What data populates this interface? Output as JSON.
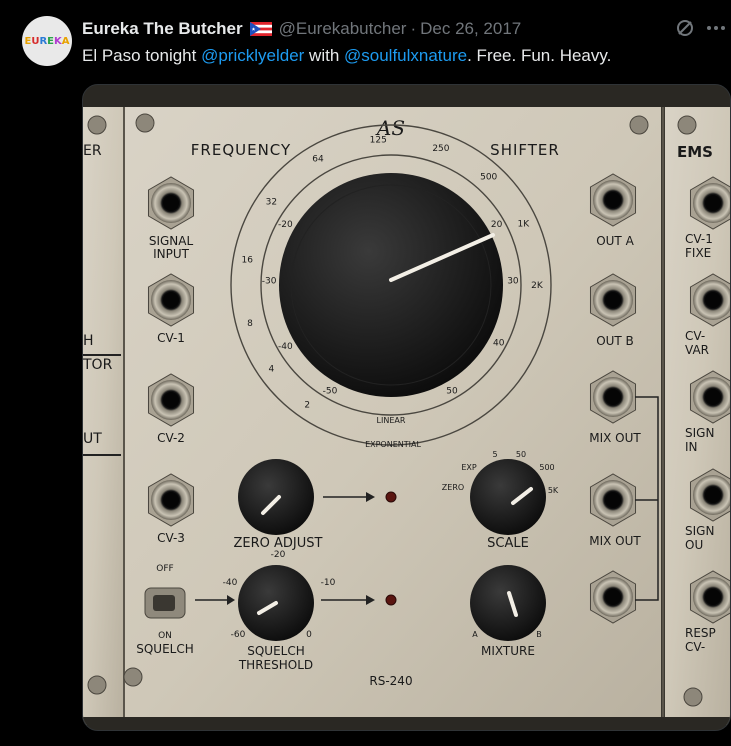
{
  "author": {
    "avatar_text": "EUREKA",
    "display_name": "Eureka The Butcher",
    "handle": "@Eurekabutcher",
    "separator": "·",
    "date": "Dec 26, 2017",
    "flag_icon": "puerto-rico-flag-icon"
  },
  "tweet": {
    "text_before": "El Paso tonight ",
    "mention_1": "@pricklyelder",
    "text_middle": " with ",
    "mention_2": "@soulfulxnature",
    "text_after": ". Free. Fun. Heavy."
  },
  "actions": {
    "grok_icon": "slashed-circle-icon",
    "more_icon": "more-icon"
  },
  "media": {
    "module": {
      "logo": "AS",
      "title_left": "FREQUENCY",
      "title_right": "SHIFTER",
      "jacks_left": [
        "SIGNAL INPUT",
        "CV-1",
        "CV-2",
        "CV-3"
      ],
      "jacks_right": [
        "OUT A",
        "OUT B",
        "MIX OUT",
        "MIX OUT"
      ],
      "dial_outer": [
        "2",
        "4",
        "8",
        "16",
        "32",
        "64",
        "125",
        "250",
        "500",
        "1K",
        "2K"
      ],
      "dial_inner": [
        "-50",
        "-40",
        "-30",
        "-20",
        "20",
        "30",
        "40",
        "50"
      ],
      "dial_labels": [
        "LINEAR",
        "EXPONENTIAL"
      ],
      "knob_zero": "ZERO ADJUST",
      "knob_squelch": "SQUELCH THRESHOLD",
      "squelch_marks": [
        "-20",
        "-40",
        "-10",
        "-60",
        "0"
      ],
      "knob_scale": "SCALE",
      "scale_marks": [
        "EXP",
        "5",
        "50",
        "500",
        "ZERO",
        "5K"
      ],
      "knob_mixture": "MIXTURE",
      "mixture_marks": [
        "A",
        "B"
      ],
      "switch_top": "OFF",
      "switch_bottom": "ON",
      "switch_label": "SQUELCH",
      "model": "RS-240",
      "right_module": "EMS",
      "right_module_labels": [
        "CV-1 FIXE",
        "CV- VAR",
        "SIGN IN",
        "SIGN OU",
        "RESP CV-"
      ],
      "left_module_labels": [
        "ER",
        "H",
        "TOR",
        "UT"
      ]
    }
  }
}
